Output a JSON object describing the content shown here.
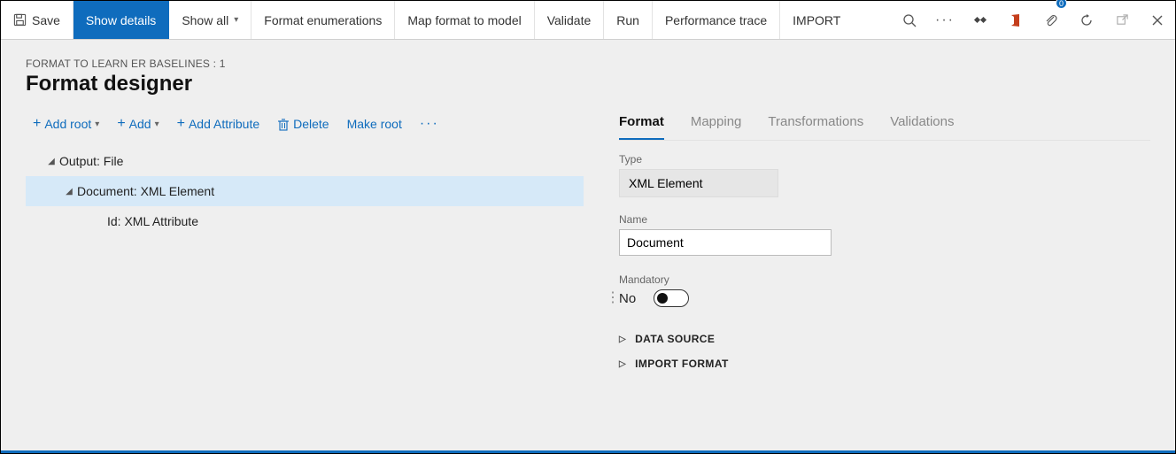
{
  "toolbar": {
    "save": "Save",
    "show_details": "Show details",
    "show_all": "Show all",
    "format_enum": "Format enumerations",
    "map_format": "Map format to model",
    "validate": "Validate",
    "run": "Run",
    "perf_trace": "Performance trace",
    "import": "IMPORT"
  },
  "badge_count": "0",
  "breadcrumb": "FORMAT TO LEARN ER BASELINES : 1",
  "page_title": "Format designer",
  "actions": {
    "add_root": "Add root",
    "add": "Add",
    "add_attribute": "Add Attribute",
    "delete": "Delete",
    "make_root": "Make root"
  },
  "tree": {
    "n1": "Output: File",
    "n2": "Document: XML Element",
    "n3": "Id: XML Attribute"
  },
  "tabs": {
    "format": "Format",
    "mapping": "Mapping",
    "transformations": "Transformations",
    "validations": "Validations"
  },
  "fields": {
    "type_label": "Type",
    "type_value": "XML Element",
    "name_label": "Name",
    "name_value": "Document",
    "mandatory_label": "Mandatory",
    "mandatory_value": "No"
  },
  "sections": {
    "data_source": "DATA SOURCE",
    "import_format": "IMPORT FORMAT"
  }
}
